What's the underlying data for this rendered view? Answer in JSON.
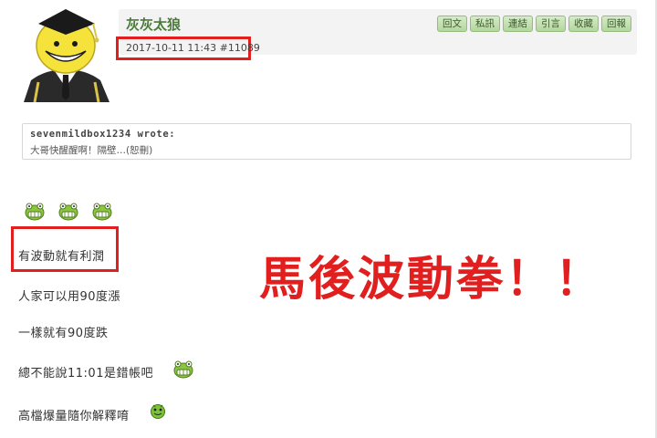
{
  "post": {
    "author": "灰灰太狼",
    "timestamp": "2017-10-11 11:43",
    "post_number": "#11089",
    "actions": [
      "回文",
      "私訊",
      "連結",
      "引言",
      "收藏",
      "回報"
    ]
  },
  "quote": {
    "author_line": "sevenmildbox1234 wrote:",
    "text": "大哥快醒醒啊！隔壁…(恕刪)"
  },
  "body": {
    "emoticon_row": [
      "frog-grin-icon",
      "frog-grin-icon",
      "frog-grin-icon"
    ],
    "lines": [
      "有波動就有利潤",
      "人家可以用90度漲",
      "一樣就有90度跌",
      "總不能說11:01是錯帳吧",
      "高檔爆量隨你解釋唷"
    ],
    "line_emoticons": {
      "line4": "frog-grin-icon",
      "line5": "green-blob-icon"
    }
  },
  "annotation": {
    "text": "馬後波動拳！！",
    "color": "#e21f1f"
  },
  "colors": {
    "highlight_red": "#e21f1f",
    "author_green": "#4a7a3a",
    "button_green": "#b4d69e"
  }
}
